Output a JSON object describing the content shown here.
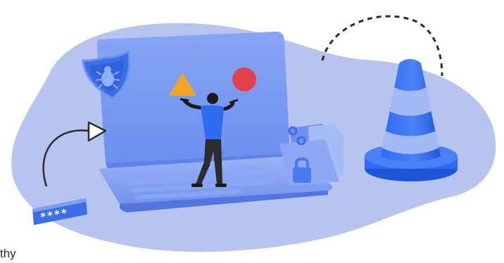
{
  "illustration": {
    "password_field_text": "****",
    "caption_fragment": "thy",
    "colors": {
      "blob": "#b7c4f0",
      "laptop_screen": "#7a9af0",
      "laptop_body": "#6f90ee",
      "accent_blue": "#2f6bf2",
      "triangle": "#f4a422",
      "circle": "#e3404f",
      "person_shirt": "#2f6bf2",
      "person_pants": "#2c2c2c"
    },
    "icons": [
      "shield-bug-icon",
      "arrow-icon",
      "password-field-icon",
      "folder-lock-icon",
      "traffic-cone-icon",
      "dashed-arc-icon"
    ]
  }
}
